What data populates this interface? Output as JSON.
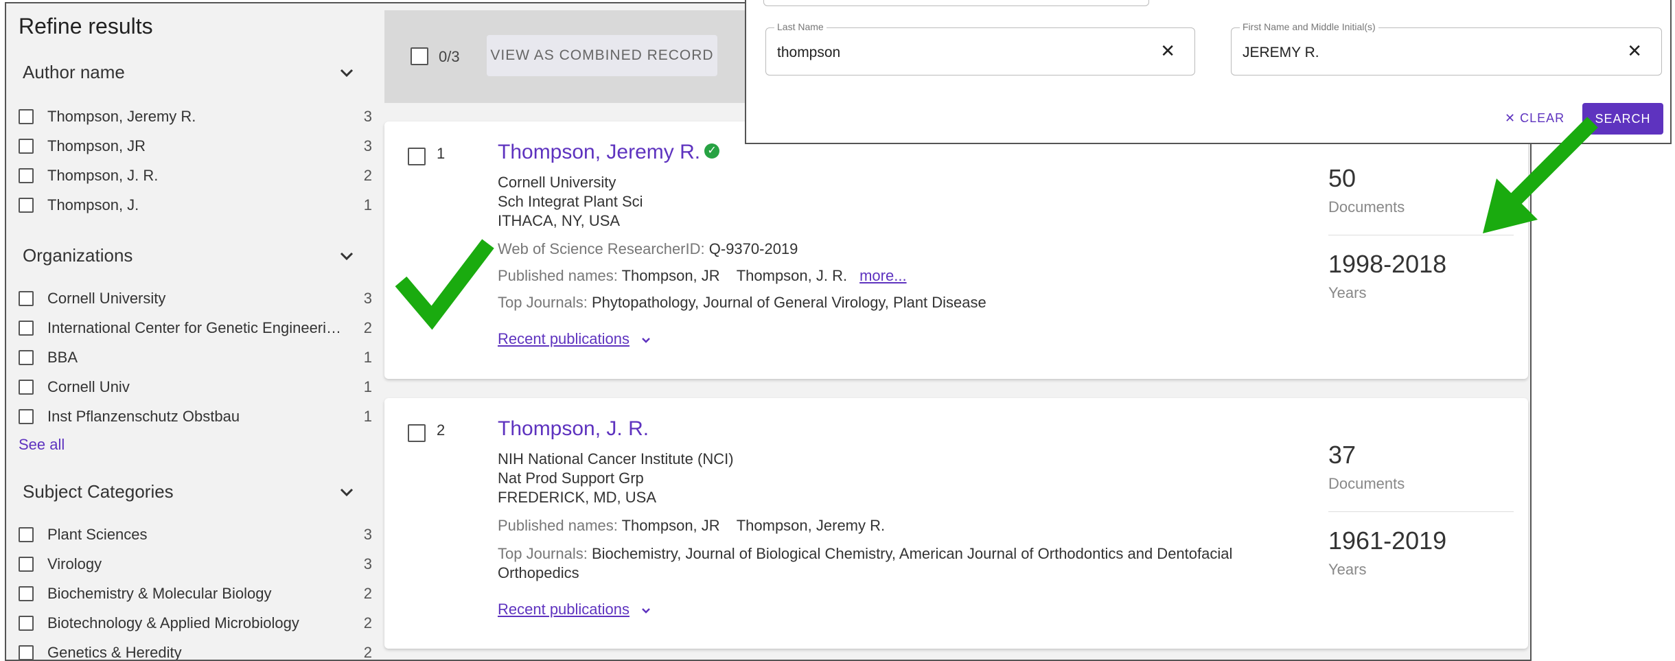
{
  "sidebar": {
    "title": "Refine results",
    "facets": [
      {
        "heading": "Author name",
        "items": [
          {
            "label": "Thompson, Jeremy R.",
            "count": "3"
          },
          {
            "label": "Thompson, JR",
            "count": "3"
          },
          {
            "label": "Thompson, J. R.",
            "count": "2"
          },
          {
            "label": "Thompson, J.",
            "count": "1"
          }
        ]
      },
      {
        "heading": "Organizations",
        "items": [
          {
            "label": "Cornell University",
            "count": "3"
          },
          {
            "label": "International Center for Genetic Engineering and Biotechnology",
            "count": "2"
          },
          {
            "label": "BBA",
            "count": "1"
          },
          {
            "label": "Cornell Univ",
            "count": "1"
          },
          {
            "label": "Inst Pflanzenschutz Obstbau",
            "count": "1"
          }
        ],
        "see_all": "See all"
      },
      {
        "heading": "Subject Categories",
        "items": [
          {
            "label": "Plant Sciences",
            "count": "3"
          },
          {
            "label": "Virology",
            "count": "3"
          },
          {
            "label": "Biochemistry & Molecular Biology",
            "count": "2"
          },
          {
            "label": "Biotechnology & Applied Microbiology",
            "count": "2"
          },
          {
            "label": "Genetics & Heredity",
            "count": "2"
          }
        ]
      }
    ]
  },
  "toolbar": {
    "selected_count": "0/3",
    "combined_label": "VIEW AS COMBINED RECORD"
  },
  "results": [
    {
      "index": "1",
      "name": "Thompson, Jeremy R.",
      "verified": true,
      "affiliation": [
        "Cornell University",
        "Sch Integrat Plant Sci",
        "ITHACA, NY, USA"
      ],
      "researcher_id_label": "Web of Science ResearcherID:",
      "researcher_id": "Q-9370-2019",
      "published_names_label": "Published names:",
      "published_names": "Thompson, JR    Thompson, J. R.",
      "more_label": "more...",
      "top_journals_label": "Top Journals:",
      "top_journals": "Phytopathology, Journal of General Virology, Plant Disease",
      "recent_label": "Recent publications",
      "documents": "50",
      "documents_label": "Documents",
      "years": "1998-2018",
      "years_label": "Years"
    },
    {
      "index": "2",
      "name": "Thompson, J. R.",
      "verified": false,
      "affiliation": [
        "NIH National Cancer Institute (NCI)",
        "Nat Prod Support Grp",
        "FREDERICK, MD, USA"
      ],
      "published_names_label": "Published names:",
      "published_names": "Thompson, JR    Thompson, Jeremy R.",
      "top_journals_label": "Top Journals:",
      "top_journals_line1": "Biochemistry, Journal of Biological Chemistry, American Journal of Orthodontics and Dentofacial",
      "top_journals_line2": "Orthopedics",
      "recent_label": "Recent publications",
      "documents": "37",
      "documents_label": "Documents",
      "years": "1961-2019",
      "years_label": "Years"
    }
  ],
  "search_panel": {
    "last_name_label": "Last Name",
    "last_name_value": "thompson",
    "first_name_label": "First Name and Middle Initial(s)",
    "first_name_value": "JEREMY R.",
    "clear_label": "CLEAR",
    "search_label": "SEARCH"
  },
  "colors": {
    "accent": "#5e33bf",
    "annotation_green": "#1aab0f",
    "verified_green": "#27a243"
  }
}
